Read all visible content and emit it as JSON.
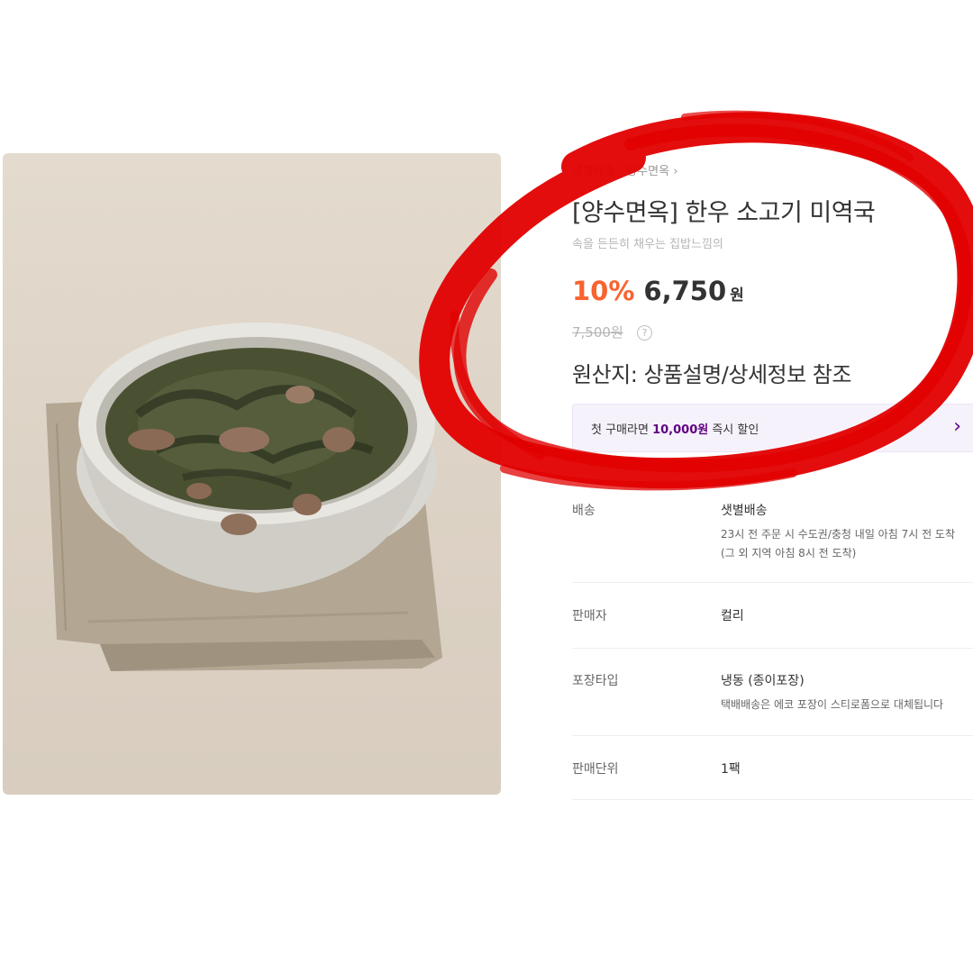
{
  "breadcrumb": {
    "text": "샛별배송 · 양수면옥 ›"
  },
  "product": {
    "title": "[양수면옥] 한우 소고기 미역국",
    "subtitle": "속을 든든히 채우는 집밥느낌의",
    "discount": "10%",
    "price": "6,750",
    "currency": "원",
    "original_price": "7,500원",
    "help_icon": "?",
    "origin": "원산지: 상품설명/상세정보 참조"
  },
  "coupon": {
    "prefix": "첫 구매라면 ",
    "amount": "10,000원",
    "suffix": " 즉시 할인",
    "arrow": "›"
  },
  "details": {
    "delivery_label": "배송",
    "delivery_value": "샛별배송",
    "delivery_note1": "23시 전 주문 시 수도권/충청 내일 아침 7시 전 도착",
    "delivery_note2": "(그 외 지역 아침 8시 전 도착)",
    "seller_label": "판매자",
    "seller_value": "컬리",
    "package_label": "포장타입",
    "package_value": "냉동 (종이포장)",
    "package_note": "택배배송은 에코 포장이 스티로폼으로 대체됩니다",
    "unit_label": "판매단위",
    "unit_value": "1팩"
  },
  "colors": {
    "discount": "#fa622f",
    "brand": "#5f0080",
    "scribble": "#e10000"
  },
  "icons": {
    "photo": "seaweed-soup-image",
    "scribble": "red-circle-annotation"
  }
}
